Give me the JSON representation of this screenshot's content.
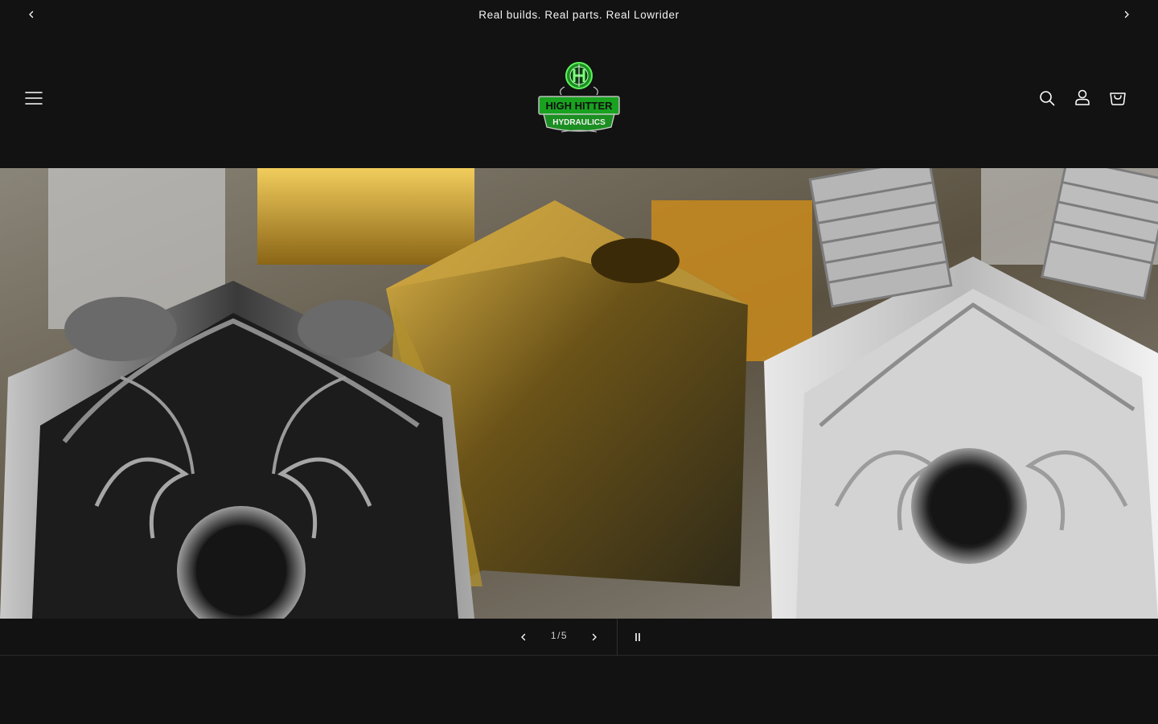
{
  "announcement": {
    "text": "Real builds. Real parts. Real Lowrider",
    "prev_icon": "chevron-left-icon",
    "next_icon": "chevron-right-icon"
  },
  "header": {
    "logo": {
      "text_line1": "HIGH HITTER",
      "text_line2": "HYDRAULICS",
      "colors": {
        "green": "#2fd13a",
        "dark_green": "#0f5e17",
        "silver": "#d9d9d9"
      }
    },
    "icons": [
      "menu-icon",
      "search-icon",
      "account-icon",
      "cart-icon"
    ]
  },
  "slideshow": {
    "current": "1",
    "separator": "/",
    "total": "5",
    "controls": [
      "chevron-left-icon",
      "chevron-right-icon",
      "pause-icon"
    ]
  },
  "colors": {
    "background": "#121212",
    "text": "#ffffff"
  }
}
